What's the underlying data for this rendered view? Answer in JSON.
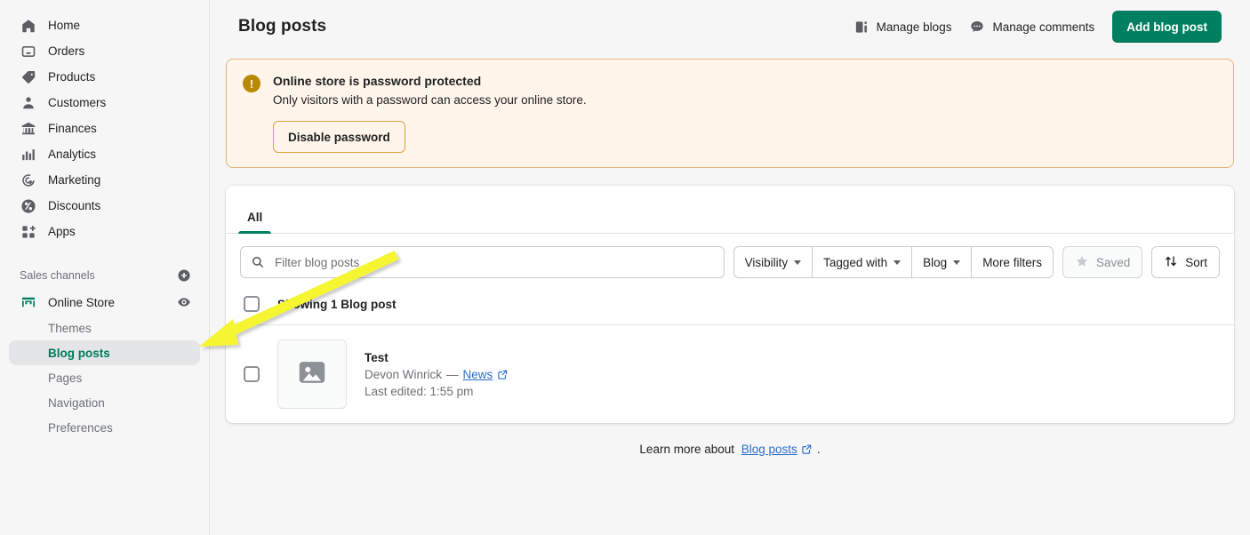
{
  "sidebar": {
    "nav_items": [
      {
        "label": "Home",
        "icon": "home-icon"
      },
      {
        "label": "Orders",
        "icon": "orders-icon"
      },
      {
        "label": "Products",
        "icon": "tag-icon"
      },
      {
        "label": "Customers",
        "icon": "person-icon"
      },
      {
        "label": "Finances",
        "icon": "bank-icon"
      },
      {
        "label": "Analytics",
        "icon": "bar-chart-icon"
      },
      {
        "label": "Marketing",
        "icon": "target-icon"
      },
      {
        "label": "Discounts",
        "icon": "percent-icon"
      },
      {
        "label": "Apps",
        "icon": "apps-grid-icon"
      }
    ],
    "sales_channels_label": "Sales channels",
    "add_channel_icon": "plus-circle-icon",
    "online_store": {
      "label": "Online Store",
      "icon": "storefront-icon",
      "preview_icon": "eye-icon"
    },
    "sub_items": [
      {
        "label": "Themes",
        "active": false
      },
      {
        "label": "Blog posts",
        "active": true
      },
      {
        "label": "Pages",
        "active": false
      },
      {
        "label": "Navigation",
        "active": false
      },
      {
        "label": "Preferences",
        "active": false
      }
    ]
  },
  "header": {
    "title": "Blog posts",
    "manage_blogs_label": "Manage blogs",
    "manage_blogs_icon": "blog-list-icon",
    "manage_comments_label": "Manage comments",
    "manage_comments_icon": "comment-icon",
    "add_blog_post_label": "Add blog post"
  },
  "banner": {
    "icon": "alert-exclamation-icon",
    "title": "Online store is password protected",
    "text": "Only visitors with a password can access your online store.",
    "button_label": "Disable password",
    "background_color": "#fff5ea",
    "border_color": "#e1b878",
    "icon_color": "#b98900"
  },
  "card": {
    "tabs": [
      {
        "label": "All",
        "active": true
      }
    ],
    "search": {
      "placeholder": "Filter blog posts",
      "value": "",
      "icon": "search-icon"
    },
    "filters": [
      {
        "label": "Visibility",
        "has_caret": true
      },
      {
        "label": "Tagged with",
        "has_caret": true
      },
      {
        "label": "Blog",
        "has_caret": true
      },
      {
        "label": "More filters",
        "has_caret": false
      }
    ],
    "saved_button": {
      "label": "Saved",
      "icon": "star-icon",
      "disabled": true
    },
    "sort_button": {
      "label": "Sort",
      "icon": "sort-arrows-icon"
    },
    "showing_label": "Showing 1 Blog post",
    "posts": [
      {
        "title": "Test",
        "author": "Devon Winrick",
        "separator": "—",
        "blog": "News",
        "blog_link_icon": "external-link-icon",
        "last_edited": "Last edited: 1:55 pm",
        "thumbnail_icon": "image-placeholder-icon"
      }
    ]
  },
  "footer": {
    "prefix": "Learn more about",
    "link_label": "Blog posts",
    "link_icon": "external-link-icon",
    "suffix": "."
  },
  "annotation": {
    "type": "arrow",
    "color": "#f7f733",
    "points_to": "sidebar-item-blog-posts"
  },
  "theme": {
    "accent": "#008060",
    "active_nav_text": "#007b5c",
    "link": "#2c6ecb",
    "page_background": "#f6f6f7"
  }
}
